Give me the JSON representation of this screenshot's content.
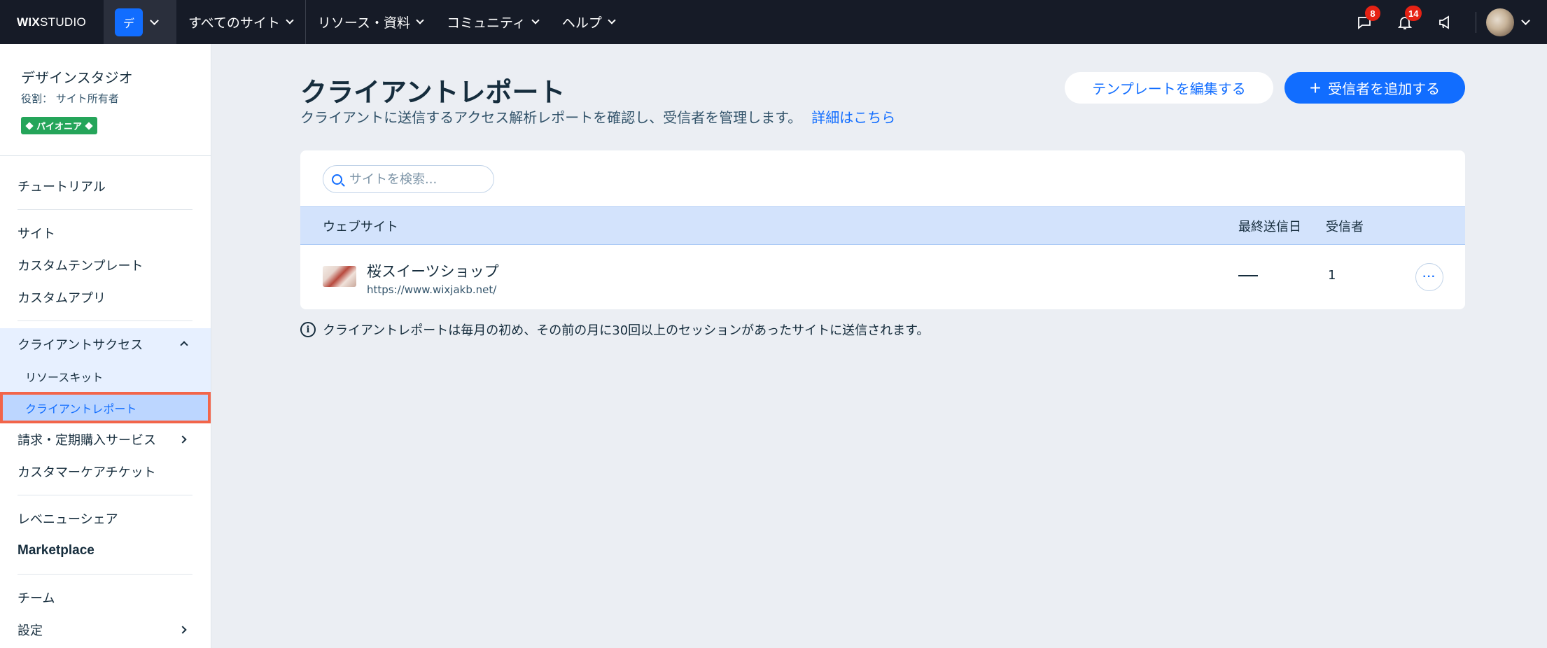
{
  "topbar": {
    "logo_bold": "WIX",
    "logo_light": "STUDIO",
    "workspace_chip": "デ",
    "nav": [
      {
        "label": "すべてのサイト"
      },
      {
        "label": "リソース・資料"
      },
      {
        "label": "コミュニティ"
      },
      {
        "label": "ヘルプ"
      }
    ],
    "messages_badge": "8",
    "notifications_badge": "14",
    "icons": [
      "chat-icon",
      "bell-icon",
      "megaphone-icon",
      "avatar",
      "chevron-down-icon"
    ]
  },
  "sidebar": {
    "workspace_name": "デザインスタジオ",
    "role": "役割： サイト所有者",
    "pill": "パイオニア",
    "items": [
      {
        "label": "チュートリアル"
      },
      {
        "label": "サイト"
      },
      {
        "label": "カスタムテンプレート"
      },
      {
        "label": "カスタムアプリ"
      },
      {
        "label": "クライアントサクセス"
      },
      {
        "label": "リソースキット"
      },
      {
        "label": "クライアントレポート"
      },
      {
        "label": "請求・定期購入サービス"
      },
      {
        "label": "カスタマーケアチケット"
      },
      {
        "label": "レベニューシェア"
      },
      {
        "label": "Marketplace"
      },
      {
        "label": "チーム"
      },
      {
        "label": "設定"
      }
    ]
  },
  "main": {
    "title": "クライアントレポート",
    "subtitle": "クライアントに送信するアクセス解析レポートを確認し、受信者を管理します。",
    "learn_more": "詳細はこちら",
    "edit_template_button": "テンプレートを編集する",
    "add_recipient_button": "受信者を追加する",
    "search_placeholder": "サイトを検索...",
    "table": {
      "columns": [
        "ウェブサイト",
        "最終送信日",
        "受信者"
      ],
      "rows": [
        {
          "name": "桜スイーツショップ",
          "url": "https://www.wixjakb.net/",
          "last_sent": "—",
          "recipients": "1"
        }
      ]
    },
    "notice": "クライアントレポートは毎月の初め、その前の月に30回以上のセッションがあったサイトに送信されます。"
  },
  "colors": {
    "topbar": "#161b27",
    "accent": "#116dff",
    "badge": "#e62214",
    "pill": "#25a55a",
    "selected_outline": "#f2654a"
  }
}
